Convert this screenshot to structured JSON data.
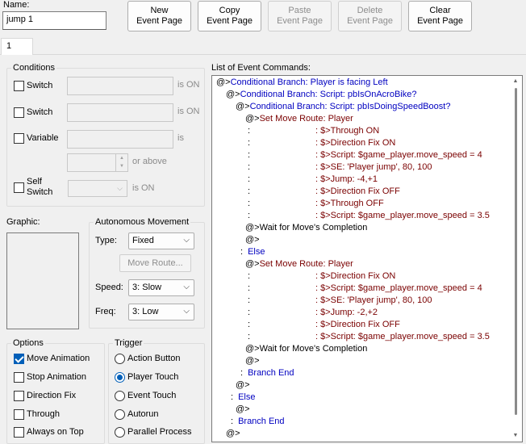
{
  "name_label": "Name:",
  "name_value": "jump 1",
  "toolbar": {
    "new": "New\nEvent Page",
    "copy": "Copy\nEvent Page",
    "paste": "Paste\nEvent Page",
    "delete": "Delete\nEvent Page",
    "clear": "Clear\nEvent Page"
  },
  "tabs": [
    "1"
  ],
  "conditions": {
    "title": "Conditions",
    "switch1": {
      "label": "Switch",
      "suffix": "is ON",
      "checked": false
    },
    "switch2": {
      "label": "Switch",
      "suffix": "is ON",
      "checked": false
    },
    "variable": {
      "label": "Variable",
      "suffix": "is",
      "or_above": "or above",
      "checked": false
    },
    "self_switch": {
      "label1": "Self",
      "label2": "Switch",
      "suffix": "is ON",
      "checked": false
    }
  },
  "graphic_label": "Graphic:",
  "autonomous": {
    "title": "Autonomous Movement",
    "type_label": "Type:",
    "type_value": "Fixed",
    "move_route": "Move Route...",
    "speed_label": "Speed:",
    "speed_value": "3: Slow",
    "freq_label": "Freq:",
    "freq_value": "3: Low"
  },
  "options": {
    "title": "Options",
    "items": [
      {
        "label": "Move Animation",
        "checked": true
      },
      {
        "label": "Stop Animation",
        "checked": false
      },
      {
        "label": "Direction Fix",
        "checked": false
      },
      {
        "label": "Through",
        "checked": false
      },
      {
        "label": "Always on Top",
        "checked": false
      }
    ]
  },
  "trigger": {
    "title": "Trigger",
    "items": [
      {
        "label": "Action Button",
        "selected": false
      },
      {
        "label": "Player Touch",
        "selected": true
      },
      {
        "label": "Event Touch",
        "selected": false
      },
      {
        "label": "Autorun",
        "selected": false
      },
      {
        "label": "Parallel Process",
        "selected": false
      }
    ]
  },
  "event_list": {
    "title": "List of Event Commands:",
    "lines": [
      {
        "indent": 0,
        "prefix": "@>",
        "text": "Conditional Branch: Player is facing Left",
        "color": "blue"
      },
      {
        "indent": 1,
        "prefix": "@>",
        "text": "Conditional Branch: Script: pbIsOnAcroBike?",
        "color": "blue"
      },
      {
        "indent": 2,
        "prefix": "@>",
        "text": "Conditional Branch: Script: pbIsDoingSpeedBoost?",
        "color": "blue"
      },
      {
        "indent": 3,
        "prefix": "@>",
        "text": "Set Move Route: Player",
        "color": "red"
      },
      {
        "indent": 3,
        "prefix": " :",
        "route": true,
        "text": ": $>Through ON",
        "color": "red"
      },
      {
        "indent": 3,
        "prefix": " :",
        "route": true,
        "text": ": $>Direction Fix ON",
        "color": "red"
      },
      {
        "indent": 3,
        "prefix": " :",
        "route": true,
        "text": ": $>Script: $game_player.move_speed = 4",
        "color": "red"
      },
      {
        "indent": 3,
        "prefix": " :",
        "route": true,
        "text": ": $>SE: 'Player jump', 80, 100",
        "color": "red"
      },
      {
        "indent": 3,
        "prefix": " :",
        "route": true,
        "text": ": $>Jump: -4,+1",
        "color": "red"
      },
      {
        "indent": 3,
        "prefix": " :",
        "route": true,
        "text": ": $>Direction Fix OFF",
        "color": "red"
      },
      {
        "indent": 3,
        "prefix": " :",
        "route": true,
        "text": ": $>Through OFF",
        "color": "red"
      },
      {
        "indent": 3,
        "prefix": " :",
        "route": true,
        "text": ": $>Script: $game_player.move_speed = 3.5",
        "color": "red"
      },
      {
        "indent": 3,
        "prefix": "@>",
        "text": "Wait for Move's Completion",
        "color": "black"
      },
      {
        "indent": 3,
        "prefix": "@>",
        "text": "",
        "color": "black"
      },
      {
        "indent": 2.5,
        "prefix": ":",
        "text": "Else",
        "color": "blue"
      },
      {
        "indent": 3,
        "prefix": "@>",
        "text": "Set Move Route: Player",
        "color": "red"
      },
      {
        "indent": 3,
        "prefix": " :",
        "route": true,
        "text": ": $>Direction Fix ON",
        "color": "red"
      },
      {
        "indent": 3,
        "prefix": " :",
        "route": true,
        "text": ": $>Script: $game_player.move_speed = 4",
        "color": "red"
      },
      {
        "indent": 3,
        "prefix": " :",
        "route": true,
        "text": ": $>SE: 'Player jump', 80, 100",
        "color": "red"
      },
      {
        "indent": 3,
        "prefix": " :",
        "route": true,
        "text": ": $>Jump: -2,+2",
        "color": "red"
      },
      {
        "indent": 3,
        "prefix": " :",
        "route": true,
        "text": ": $>Direction Fix OFF",
        "color": "red"
      },
      {
        "indent": 3,
        "prefix": " :",
        "route": true,
        "text": ": $>Script: $game_player.move_speed = 3.5",
        "color": "red"
      },
      {
        "indent": 3,
        "prefix": "@>",
        "text": "Wait for Move's Completion",
        "color": "black"
      },
      {
        "indent": 3,
        "prefix": "@>",
        "text": "",
        "color": "black"
      },
      {
        "indent": 2.5,
        "prefix": ":",
        "text": "Branch End",
        "color": "blue"
      },
      {
        "indent": 2,
        "prefix": "@>",
        "text": "",
        "color": "black"
      },
      {
        "indent": 1.5,
        "prefix": ":",
        "text": "Else",
        "color": "blue"
      },
      {
        "indent": 2,
        "prefix": "@>",
        "text": "",
        "color": "black"
      },
      {
        "indent": 1.5,
        "prefix": ":",
        "text": "Branch End",
        "color": "blue"
      },
      {
        "indent": 1,
        "prefix": "@>",
        "text": "",
        "color": "black"
      }
    ]
  }
}
